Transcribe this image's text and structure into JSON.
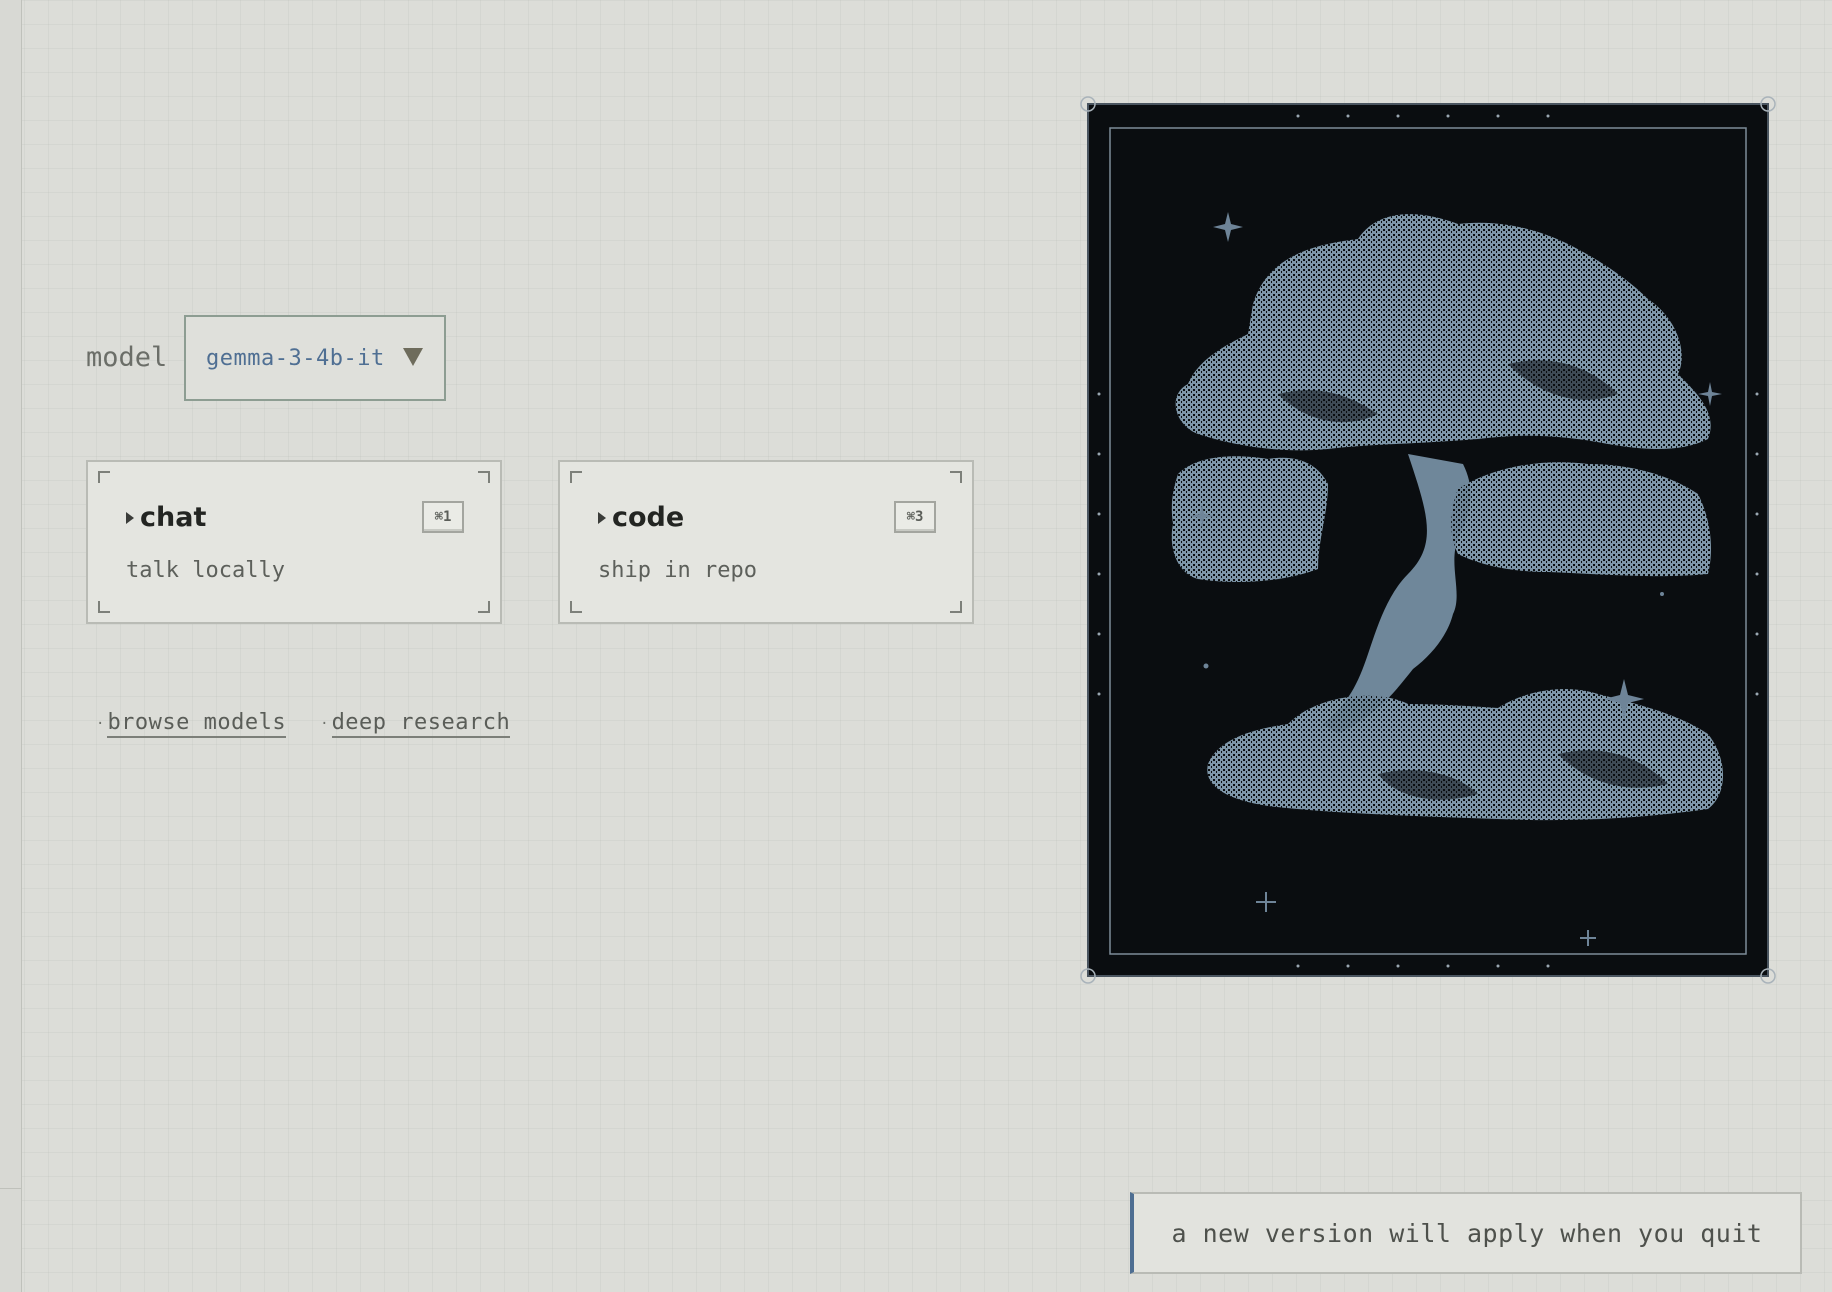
{
  "model": {
    "label": "model",
    "selected": "gemma-3-4b-it"
  },
  "modes": [
    {
      "title": "chat",
      "description": "talk locally",
      "shortcut": "⌘1"
    },
    {
      "title": "code",
      "description": "ship in repo",
      "shortcut": "⌘3"
    }
  ],
  "links": [
    {
      "label": "browse models"
    },
    {
      "label": "deep research"
    }
  ],
  "notice": {
    "message": "a new version will apply when you quit"
  },
  "colors": {
    "background": "#dcddd8",
    "accent_blue": "#4f6f93",
    "art_background": "#0a0d10",
    "art_foliage": "#8ea6b8",
    "art_stars": "#6e8498"
  },
  "icons": {
    "model_dropdown": "caret-down-icon",
    "mode_marker": "play-triangle-icon",
    "link_marker": "dot-icon"
  }
}
